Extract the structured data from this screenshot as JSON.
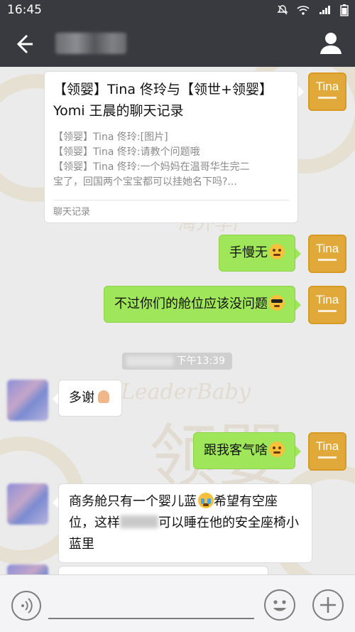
{
  "status_bar": {
    "time": "16:45"
  },
  "header": {
    "title": ""
  },
  "chat_record": {
    "title": "【领婴】Tina 佟玲与【领世+领婴】Yomi 王晨的聊天记录",
    "lines": [
      "【领婴】Tina 佟玲:[图片]",
      "【领婴】Tina 佟玲:请教个问题哦",
      "【领婴】Tina 佟玲:一个妈妈在温哥华生完二",
      "宝了，回国两个宝宝都可以挂她名下吗?..."
    ],
    "footer": "聊天记录"
  },
  "messages": {
    "m1": "手慢无",
    "m2": "不过你们的舱位应该没问题",
    "time": "下午13:39",
    "m3": "多谢",
    "m4": "跟我客气啥",
    "m5_a": "商务舱只有一个婴儿蓝",
    "m5_b": "希望有空座位，这样",
    "m5_c": "可以睡在他的安全座椅小蓝里"
  },
  "avatar_me": {
    "name": "Tina"
  },
  "watermark": {
    "cn": "领婴",
    "en": "LeaderBaby",
    "sub": "海外孕产"
  },
  "icons": {
    "back": "back-arrow-icon",
    "profile": "profile-icon",
    "voice": "voice-icon",
    "emoji": "emoji-icon",
    "plus": "plus-icon"
  }
}
